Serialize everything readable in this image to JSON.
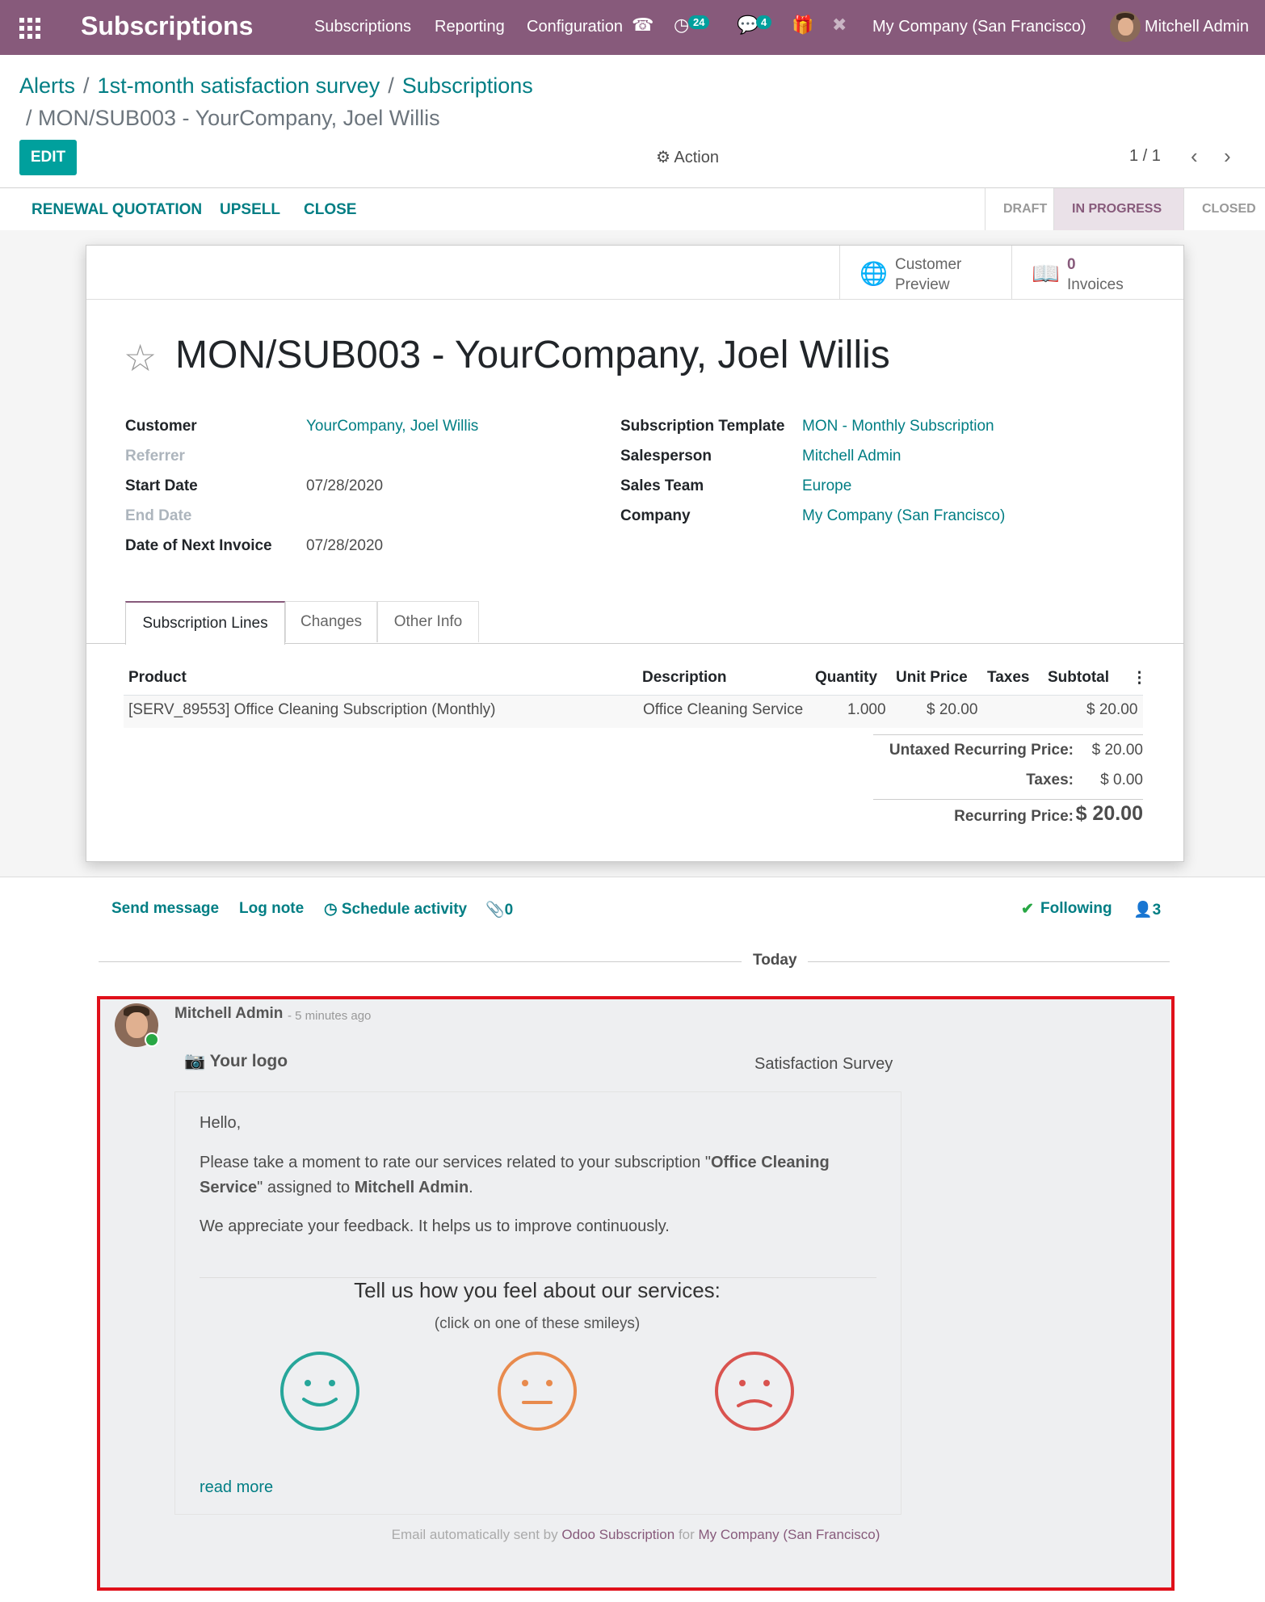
{
  "navbar": {
    "app_title": "Subscriptions",
    "menu": [
      "Subscriptions",
      "Reporting",
      "Configuration"
    ],
    "activity_count": "24",
    "message_count": "4",
    "company": "My Company (San Francisco)",
    "user": "Mitchell Admin"
  },
  "breadcrumb": {
    "items": [
      "Alerts",
      "1st-month satisfaction survey",
      "Subscriptions"
    ],
    "current": "/ MON/SUB003 - YourCompany, Joel Willis"
  },
  "toolbar": {
    "edit": "EDIT",
    "action": "Action",
    "pager": "1 / 1"
  },
  "statusbar": {
    "buttons": [
      "RENEWAL QUOTATION",
      "UPSELL",
      "CLOSE"
    ],
    "stages": [
      "DRAFT",
      "IN PROGRESS",
      "CLOSED"
    ],
    "active_stage": "IN PROGRESS"
  },
  "smart_buttons": {
    "preview_line1": "Customer",
    "preview_line2": "Preview",
    "invoices_count": "0",
    "invoices_label": "Invoices"
  },
  "record": {
    "title": "MON/SUB003 - YourCompany, Joel Willis",
    "left_fields": [
      {
        "label": "Customer",
        "value": "YourCompany, Joel Willis"
      },
      {
        "label": "Referrer",
        "value": ""
      },
      {
        "label": "Start Date",
        "value": "07/28/2020"
      },
      {
        "label": "End Date",
        "value": ""
      },
      {
        "label": "Date of Next Invoice",
        "value": "07/28/2020"
      }
    ],
    "right_fields": [
      {
        "label": "Subscription Template",
        "value": "MON - Monthly Subscription"
      },
      {
        "label": "Salesperson",
        "value": "Mitchell Admin"
      },
      {
        "label": "Sales Team",
        "value": "Europe"
      },
      {
        "label": "Company",
        "value": "My Company (San Francisco)"
      }
    ]
  },
  "tabs": [
    "Subscription Lines",
    "Changes",
    "Other Info"
  ],
  "lines": {
    "headers": [
      "Product",
      "Description",
      "Quantity",
      "Unit Price",
      "Taxes",
      "Subtotal"
    ],
    "rows": [
      {
        "product": "[SERV_89553] Office Cleaning Subscription (Monthly)",
        "description": "Office Cleaning Service",
        "quantity": "1.000",
        "unit_price": "$ 20.00",
        "taxes": "",
        "subtotal": "$ 20.00"
      }
    ]
  },
  "totals": {
    "untaxed_label": "Untaxed Recurring Price:",
    "untaxed_value": "$ 20.00",
    "taxes_label": "Taxes:",
    "taxes_value": "$ 0.00",
    "total_label": "Recurring Price:",
    "total_value": "$ 20.00"
  },
  "chatter": {
    "send_message": "Send message",
    "log_note": "Log note",
    "schedule_activity": "Schedule activity",
    "attachments": "0",
    "following": "Following",
    "followers": "3",
    "today": "Today"
  },
  "message": {
    "author": "Mitchell Admin",
    "time": "- 5 minutes ago",
    "logo": "Your logo",
    "survey_title": "Satisfaction Survey",
    "greeting": "Hello,",
    "body_pre": "Please take a moment to rate our services related to your subscription \"",
    "body_subscription": "Office Cleaning Service",
    "body_mid": "\" assigned to ",
    "body_user": "Mitchell Admin",
    "body_post": ".",
    "appreciate": "We appreciate your feedback. It helps us to improve continuously.",
    "question": "Tell us how you feel about our services:",
    "hint": "(click on one of these smileys)",
    "read_more": "read more",
    "footer_pre": "Email automatically sent by ",
    "footer_app": "Odoo Subscription",
    "footer_for": " for ",
    "footer_company": "My Company (San Francisco)"
  },
  "colors": {
    "brand": "#875a7b",
    "accent": "#00a09d",
    "link": "#017e84",
    "highlight_border": "#e0101a"
  }
}
